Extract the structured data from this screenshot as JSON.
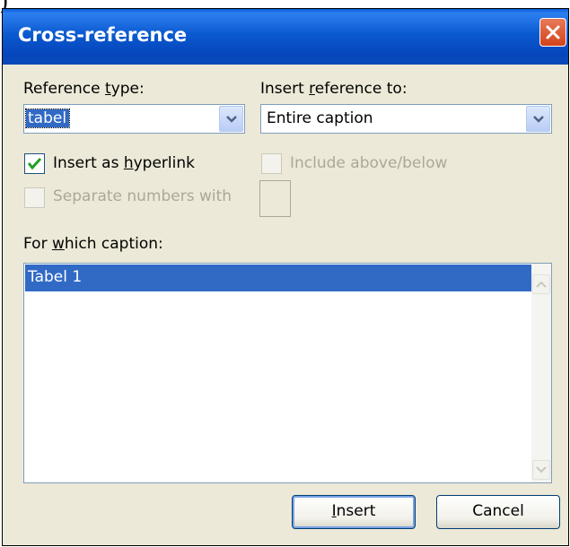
{
  "window": {
    "title": "Cross-reference",
    "external_text": ")"
  },
  "reference_type": {
    "label_pre": "Reference ",
    "label_key": "t",
    "label_post": "ype:",
    "value": "tabel"
  },
  "insert_reference_to": {
    "label_pre": "Insert ",
    "label_key": "r",
    "label_post": "eference to:",
    "value": "Entire caption"
  },
  "insert_as_hyperlink": {
    "label_pre": "Insert as ",
    "label_key": "h",
    "label_post": "yperlink",
    "checked": true
  },
  "include_above_below": {
    "label": "Include above/below",
    "checked": false,
    "disabled": true
  },
  "separate_numbers": {
    "label": "Separate numbers with",
    "checked": false,
    "disabled": true
  },
  "for_which_caption": {
    "label_pre": "For ",
    "label_key": "w",
    "label_post": "hich caption:",
    "items": [
      "Tabel 1"
    ],
    "selected_index": 0
  },
  "buttons": {
    "insert_key": "I",
    "insert_rest": "nsert",
    "cancel": "Cancel"
  },
  "colors": {
    "titlebar": "#0a5ad0",
    "selection": "#316ac5",
    "dialog_bg": "#ece9d8"
  }
}
